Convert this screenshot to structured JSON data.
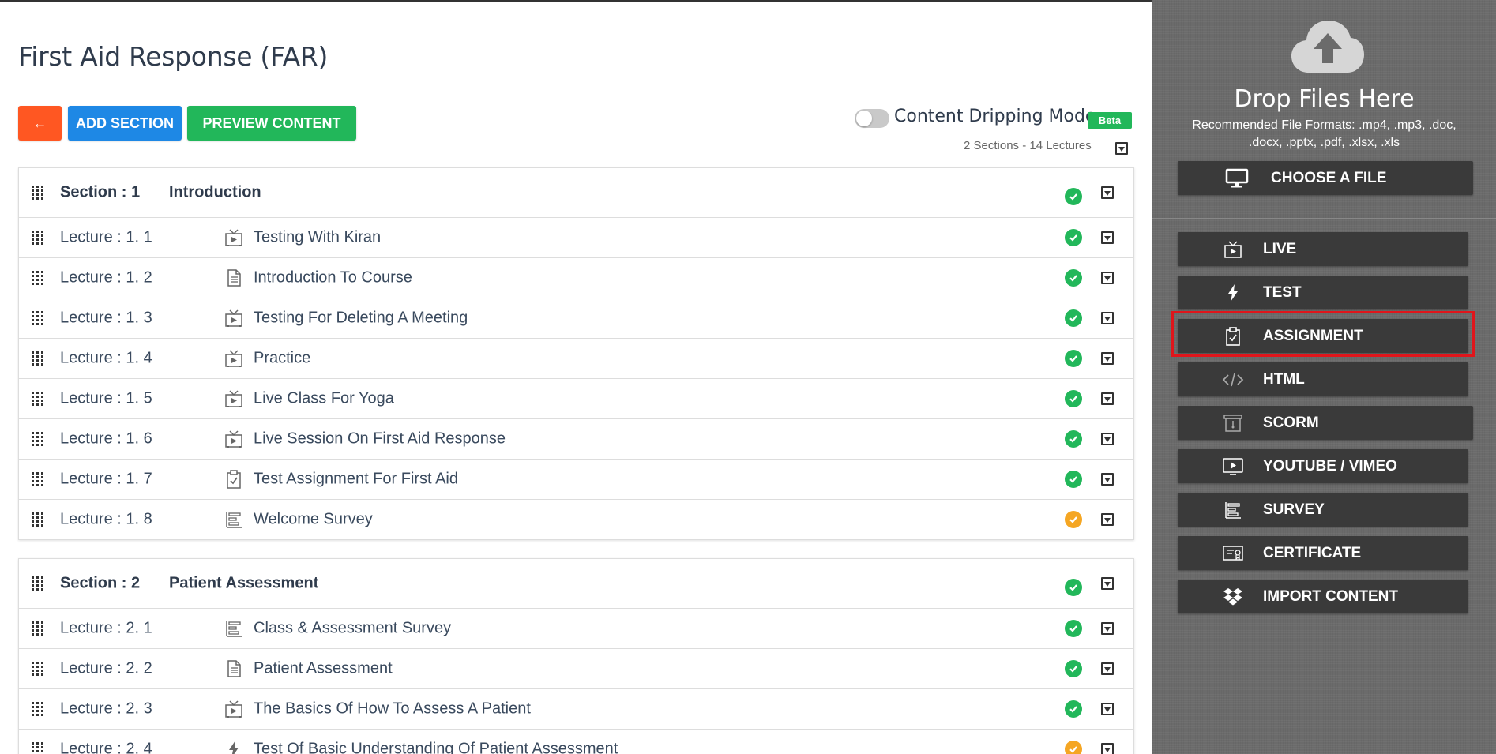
{
  "page": {
    "title": "First Aid Response (FAR)"
  },
  "toolbar": {
    "back_label": "←",
    "add_section_label": "ADD SECTION",
    "preview_label": "PREVIEW CONTENT"
  },
  "dripping": {
    "label": "Content Dripping Mode",
    "beta": "Beta",
    "enabled": false
  },
  "summary": "2 Sections - 14 Lectures",
  "colors": {
    "accent_orange": "#ff5722",
    "accent_blue": "#1e88e5",
    "accent_green": "#22b75a",
    "status_warning": "#f5a623",
    "highlight_red": "#e0151b",
    "sidebar_bg": "#6b6b6b",
    "sidebar_button": "#3a3a3a"
  },
  "sections": [
    {
      "label": "Section : 1",
      "title": "Introduction",
      "status": "complete",
      "lectures": [
        {
          "label": "Lecture : 1. 1",
          "title": "Testing With Kiran",
          "icon": "live-icon",
          "status": "complete"
        },
        {
          "label": "Lecture : 1. 2",
          "title": "Introduction To Course",
          "icon": "document-icon",
          "status": "complete"
        },
        {
          "label": "Lecture : 1. 3",
          "title": "Testing For Deleting A Meeting",
          "icon": "live-icon",
          "status": "complete"
        },
        {
          "label": "Lecture : 1. 4",
          "title": "Practice",
          "icon": "live-icon",
          "status": "complete"
        },
        {
          "label": "Lecture : 1. 5",
          "title": "Live Class For Yoga",
          "icon": "live-icon",
          "status": "complete"
        },
        {
          "label": "Lecture : 1. 6",
          "title": "Live Session On First Aid Response",
          "icon": "live-icon",
          "status": "complete"
        },
        {
          "label": "Lecture : 1. 7",
          "title": "Test Assignment For First Aid",
          "icon": "assignment-icon",
          "status": "complete"
        },
        {
          "label": "Lecture : 1. 8",
          "title": "Welcome Survey",
          "icon": "survey-icon",
          "status": "warning"
        }
      ]
    },
    {
      "label": "Section : 2",
      "title": "Patient Assessment",
      "status": "complete",
      "lectures": [
        {
          "label": "Lecture : 2. 1",
          "title": "Class & Assessment Survey",
          "icon": "survey-icon",
          "status": "complete"
        },
        {
          "label": "Lecture : 2. 2",
          "title": "Patient Assessment",
          "icon": "document-icon",
          "status": "complete"
        },
        {
          "label": "Lecture : 2. 3",
          "title": "The Basics Of How To Assess A Patient",
          "icon": "live-icon",
          "status": "complete"
        },
        {
          "label": "Lecture : 2. 4",
          "title": "Test Of Basic Understanding Of Patient Assessment",
          "icon": "test-icon",
          "status": "warning"
        }
      ]
    }
  ],
  "sidebar": {
    "drop_title": "Drop Files Here",
    "formats": "Recommended File Formats: .mp4, .mp3, .doc, .docx, .pptx, .pdf, .xlsx, .xls",
    "choose_label": "CHOOSE A FILE",
    "buttons": [
      {
        "label": "LIVE",
        "icon": "live-icon"
      },
      {
        "label": "TEST",
        "icon": "lightning-icon"
      },
      {
        "label": "ASSIGNMENT",
        "icon": "assignment-icon",
        "highlighted": true
      },
      {
        "label": "HTML",
        "icon": "code-icon"
      },
      {
        "label": "SCORM",
        "icon": "scorm-icon"
      },
      {
        "label": "YOUTUBE / VIMEO",
        "icon": "video-icon"
      },
      {
        "label": "SURVEY",
        "icon": "survey-icon"
      },
      {
        "label": "CERTIFICATE",
        "icon": "certificate-icon"
      },
      {
        "label": "IMPORT CONTENT",
        "icon": "dropbox-icon"
      }
    ]
  }
}
